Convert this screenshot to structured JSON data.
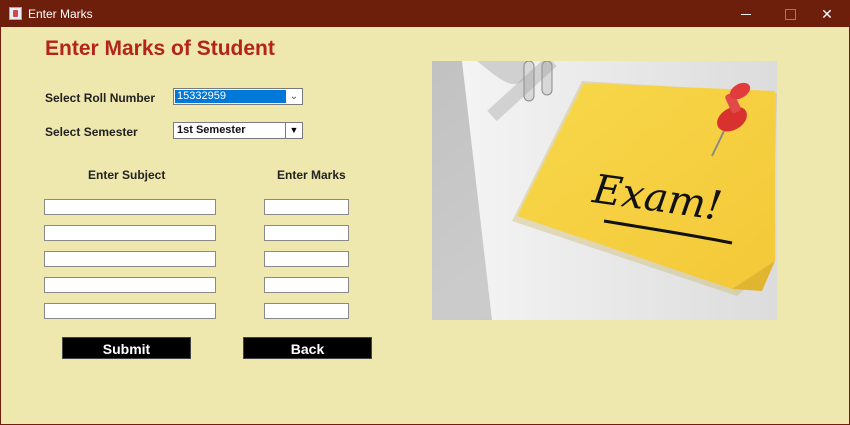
{
  "window": {
    "title": "Enter Marks",
    "controls": {
      "minimize": "",
      "maximize": "",
      "close": "✕"
    }
  },
  "form": {
    "heading": "Enter Marks of Student",
    "roll": {
      "label": "Select Roll Number",
      "value": "15332959",
      "arrow": "⌄"
    },
    "semester": {
      "label": "Select Semester",
      "value": "1st Semester",
      "arrow": "▼"
    },
    "columns": {
      "subject": "Enter Subject",
      "marks": "Enter Marks"
    },
    "rows": [
      {
        "subject": "",
        "marks": ""
      },
      {
        "subject": "",
        "marks": ""
      },
      {
        "subject": "",
        "marks": ""
      },
      {
        "subject": "",
        "marks": ""
      },
      {
        "subject": "",
        "marks": ""
      }
    ],
    "buttons": {
      "submit": "Submit",
      "back": "Back"
    }
  },
  "image": {
    "note_text": "Exam!"
  },
  "colors": {
    "background": "#eee7ae",
    "titlebar": "#6e1f0c",
    "heading": "#b3241b",
    "selection": "#0078d7"
  }
}
